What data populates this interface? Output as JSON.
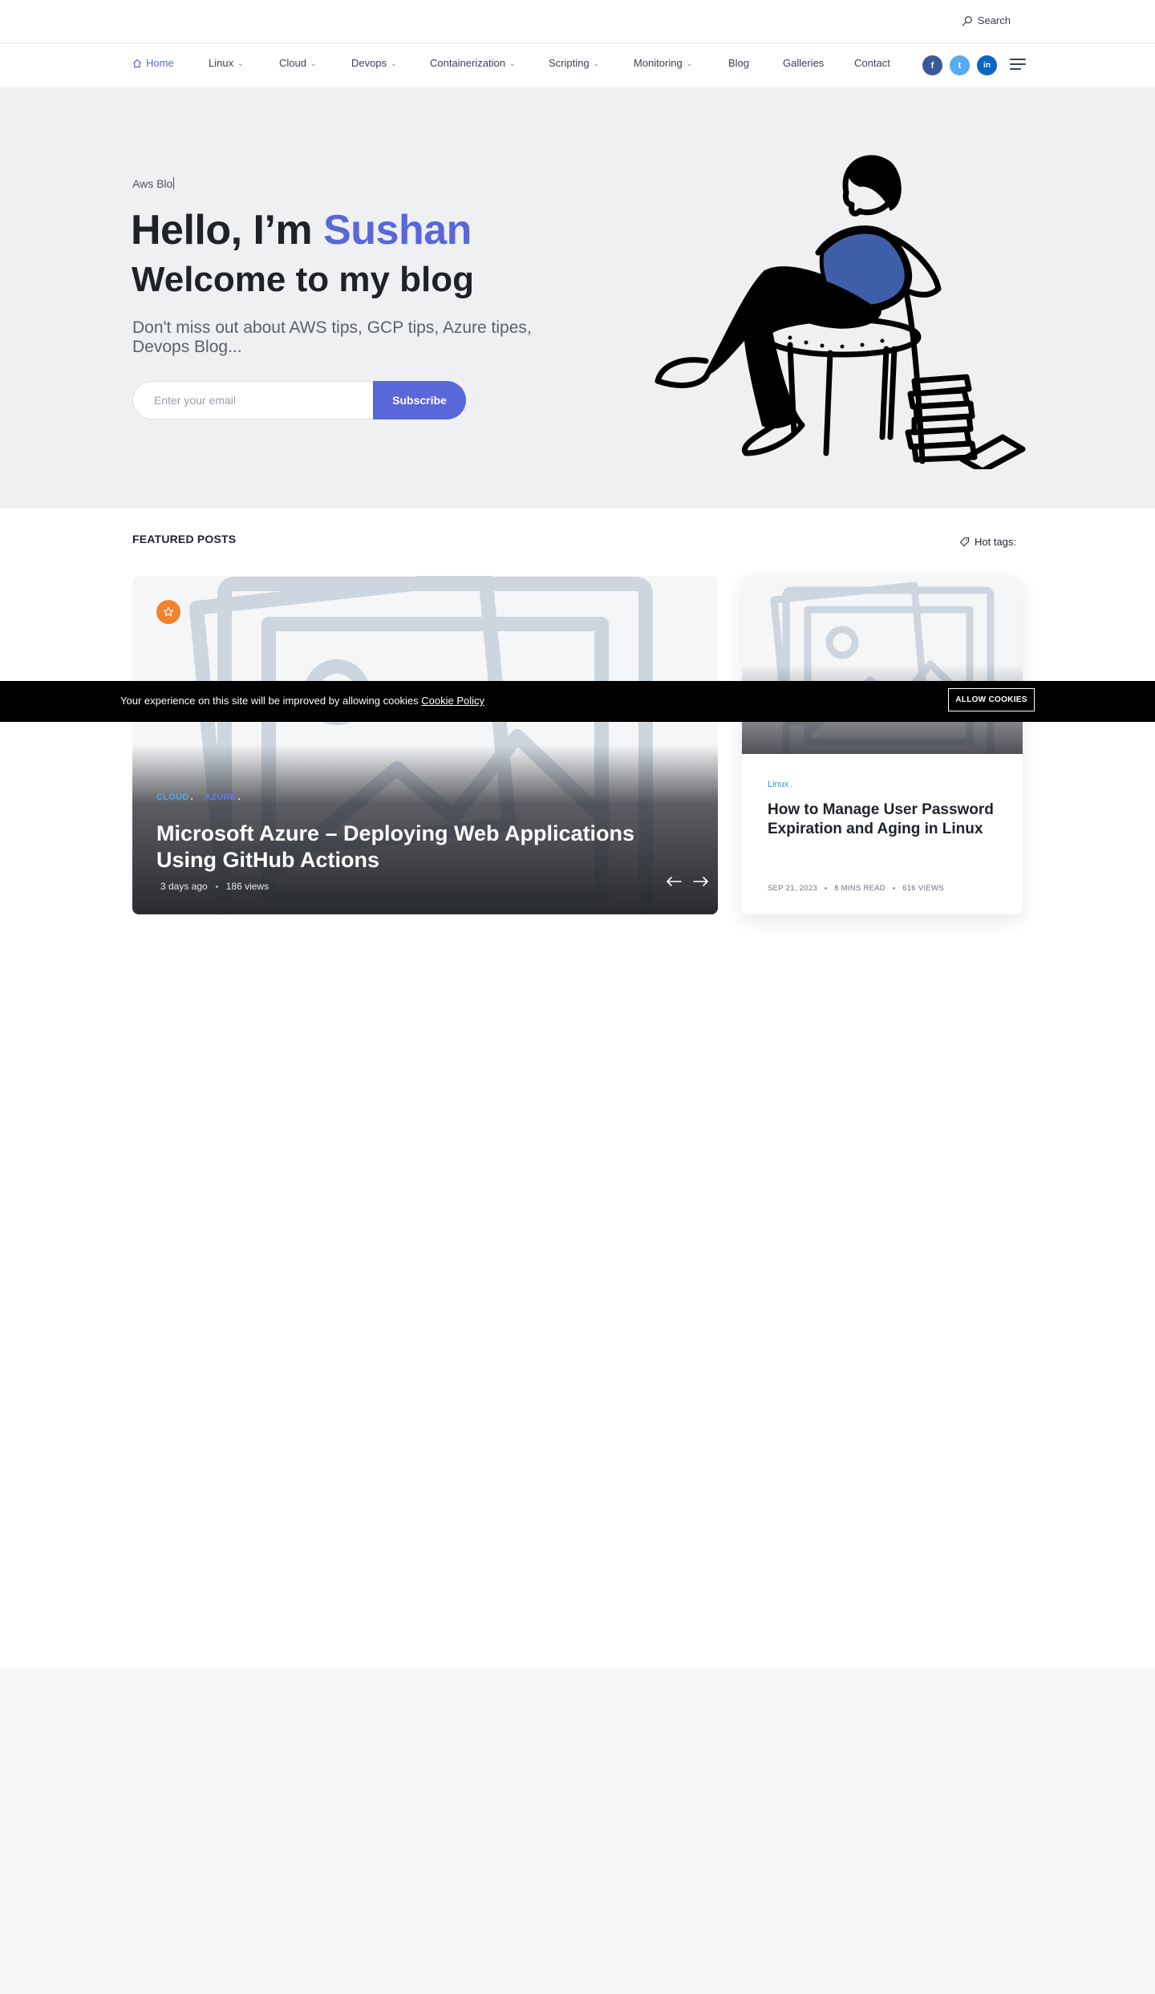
{
  "topbar": {
    "search_label": "Search"
  },
  "nav": {
    "items": [
      {
        "label": "Home",
        "active": true,
        "icon": "home-icon"
      },
      {
        "label": "Linux",
        "dropdown": true
      },
      {
        "label": "Cloud",
        "dropdown": true
      },
      {
        "label": "Devops",
        "dropdown": true
      },
      {
        "label": "Containerization",
        "dropdown": true
      },
      {
        "label": "Scripting",
        "dropdown": true
      },
      {
        "label": "Monitoring",
        "dropdown": true
      },
      {
        "label": "Blog",
        "dropdown": false
      },
      {
        "label": "Galleries",
        "dropdown": false
      },
      {
        "label": "Contact",
        "dropdown": false
      }
    ],
    "social": [
      {
        "label": "f",
        "icon": "facebook-icon",
        "color": "#3b5998"
      },
      {
        "label": "t",
        "icon": "twitter-icon",
        "color": "#55acee"
      },
      {
        "label": "in",
        "icon": "linkedin-icon",
        "color": "#0a66c2"
      }
    ],
    "chevron": "⌄"
  },
  "hero": {
    "typed_text": "Aws Blo",
    "hello_prefix": "Hello, I’m ",
    "hello_name": "Sushan",
    "welcome": "Welcome to my blog",
    "tagline": "Don't miss out about AWS tips, GCP tips, Azure tipes, Devops Blog...",
    "email_placeholder": "Enter your email",
    "subscribe_label": "Subscribe",
    "accent_color": "#5a67d8"
  },
  "featured": {
    "section_title": "FEATURED POSTS",
    "hot_tags_label": "Hot tags:",
    "main_post": {
      "categories": [
        "CLOUD",
        "AZURE"
      ],
      "title": "Microsoft Azure – Deploying Web Applications Using GitHub Actions",
      "time": "3 days ago",
      "views": "186 views",
      "badge_icon": "star-icon",
      "badge_color": "#f0832b"
    },
    "side_post": {
      "category": "Linux",
      "title": "How to Manage User Password Expiration and Aging in Linux",
      "date": "SEP 21, 2023",
      "read_time": "8 MINS READ",
      "views": "616 VIEWS"
    }
  },
  "cookie": {
    "text": "Your experience on this site will be improved by allowing cookies",
    "link": "Cookie Policy",
    "button": "ALLOW COOKIES"
  }
}
